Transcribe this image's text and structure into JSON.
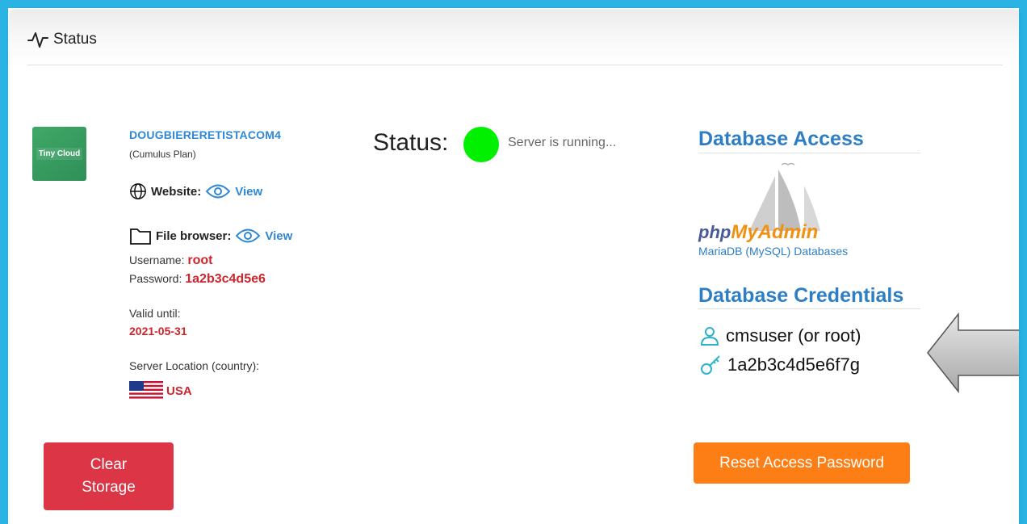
{
  "header": {
    "title": "Status",
    "icon": "activity-icon"
  },
  "account": {
    "logo_text": "Tiny Cloud",
    "name": "DOUGBIERERETISTACOM4",
    "plan": "(Cumulus Plan)",
    "website_label": "Website:",
    "website_link": "View",
    "file_browser_label": "File browser:",
    "file_browser_link": "View",
    "username_label": "Username:",
    "username_value": "root",
    "password_label": "Password:",
    "password_value": "1a2b3c4d5e6",
    "valid_until_label": "Valid until:",
    "valid_until_value": "2021-05-31",
    "location_label": "Server Location (country):",
    "location_value": "USA"
  },
  "status": {
    "label": "Status:",
    "text": "Server is running...",
    "indicator_color": "#00f000"
  },
  "database_access": {
    "title": "Database Access",
    "logo_php": "php",
    "logo_myadmin": "MyAdmin",
    "subtitle": "MariaDB (MySQL) Databases"
  },
  "database_credentials": {
    "title": "Database Credentials",
    "user": "cmsuser (or root)",
    "password": "1a2b3c4d5e6f7g"
  },
  "buttons": {
    "clear_line1": "Clear",
    "clear_line2": "Storage",
    "reset": "Reset Access Password"
  },
  "colors": {
    "frame": "#2bb3e3",
    "link": "#2e88d6",
    "danger": "#dc3545",
    "warning": "#fd7e14",
    "value_red": "#d0242b"
  }
}
